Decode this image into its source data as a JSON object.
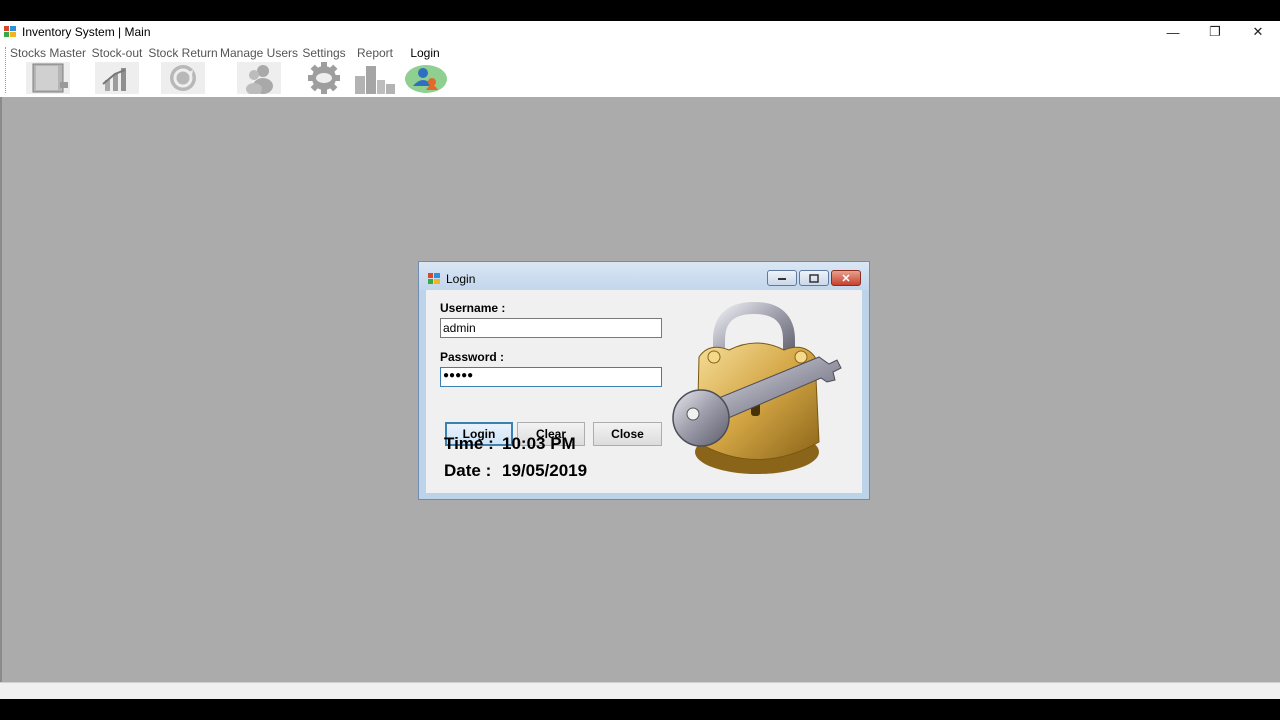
{
  "window": {
    "title": "Inventory System | Main",
    "controls": {
      "minimize": "—",
      "restore": "❐",
      "close": "✕"
    }
  },
  "toolbar": {
    "items": [
      {
        "label": "Stocks Master",
        "icon": "book-icon"
      },
      {
        "label": "Stock-out",
        "icon": "chart-icon"
      },
      {
        "label": "Stock Return",
        "icon": "refresh-icon"
      },
      {
        "label": "Manage Users",
        "icon": "users-icon"
      },
      {
        "label": "Settings",
        "icon": "gear-icon"
      },
      {
        "label": "Report",
        "icon": "report-icon"
      },
      {
        "label": "Login",
        "icon": "user-login-icon"
      }
    ]
  },
  "login_dialog": {
    "title": "Login",
    "username_label": "Username :",
    "username_value": "admin",
    "password_label": "Password :",
    "password_value": "●●●●●",
    "buttons": {
      "login": "Login",
      "clear": "Clear",
      "close": "Close"
    },
    "time_label": "Time :",
    "time_value": "10:03 PM",
    "date_label": "Date :",
    "date_value": "19/05/2019",
    "image": "padlock-key-icon"
  },
  "colors": {
    "mdi_background": "#ababab",
    "dialog_frame": "#bcd3ea",
    "focus_border": "#3c7fb1"
  }
}
